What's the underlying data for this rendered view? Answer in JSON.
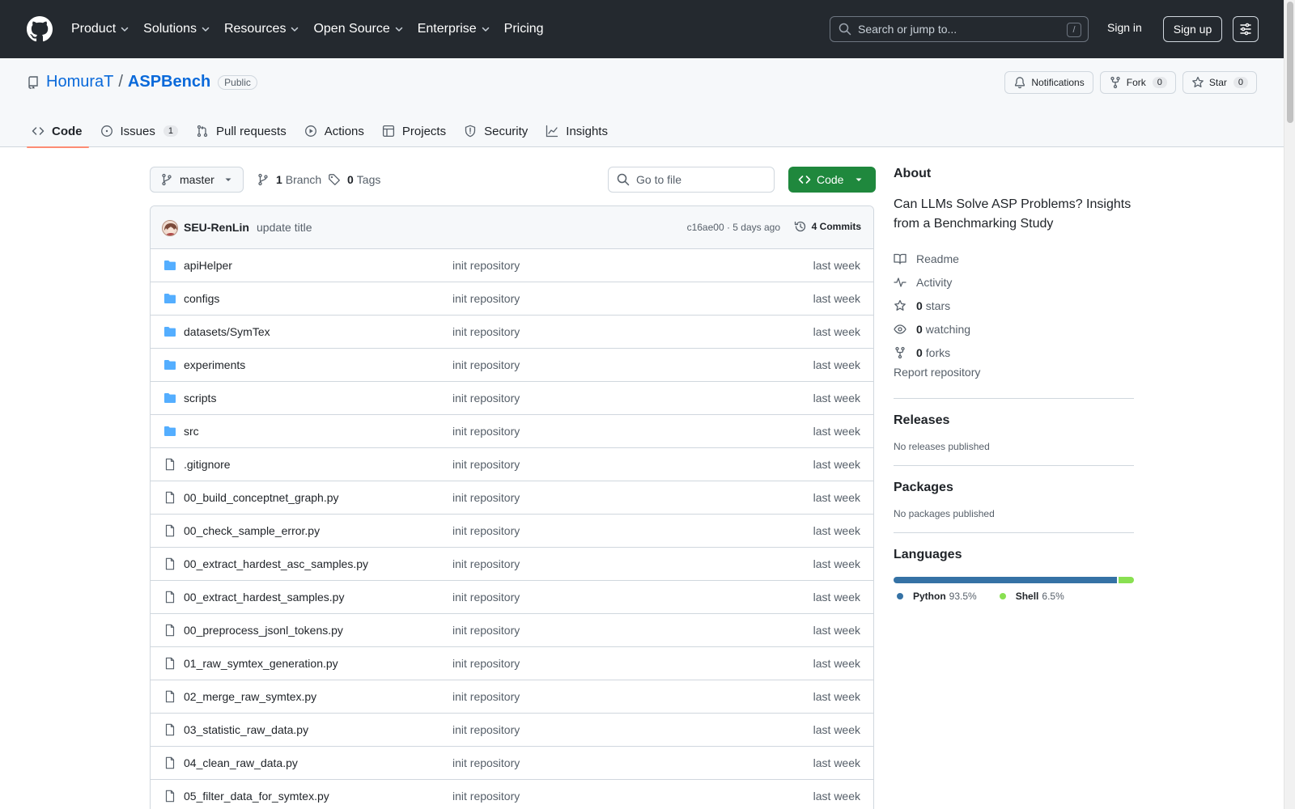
{
  "header": {
    "nav": [
      {
        "label": "Product",
        "has_menu": true
      },
      {
        "label": "Solutions",
        "has_menu": true
      },
      {
        "label": "Resources",
        "has_menu": true
      },
      {
        "label": "Open Source",
        "has_menu": true
      },
      {
        "label": "Enterprise",
        "has_menu": true
      },
      {
        "label": "Pricing",
        "has_menu": false
      }
    ],
    "search_placeholder": "Search or jump to...",
    "search_shortcut": "/",
    "sign_in": "Sign in",
    "sign_up": "Sign up"
  },
  "repo": {
    "owner": "HomuraT",
    "separator": "/",
    "name": "ASPBench",
    "visibility": "Public",
    "notifications_label": "Notifications",
    "fork_label": "Fork",
    "fork_count": "0",
    "star_label": "Star",
    "star_count": "0",
    "tabs": [
      {
        "label": "Code",
        "icon": "code-icon",
        "active": true,
        "count": ""
      },
      {
        "label": "Issues",
        "icon": "issue-icon",
        "active": false,
        "count": "1"
      },
      {
        "label": "Pull requests",
        "icon": "pull-request-icon",
        "active": false,
        "count": ""
      },
      {
        "label": "Actions",
        "icon": "play-icon",
        "active": false,
        "count": ""
      },
      {
        "label": "Projects",
        "icon": "table-icon",
        "active": false,
        "count": ""
      },
      {
        "label": "Security",
        "icon": "shield-icon",
        "active": false,
        "count": ""
      },
      {
        "label": "Insights",
        "icon": "graph-icon",
        "active": false,
        "count": ""
      }
    ]
  },
  "toolbar": {
    "branch": "master",
    "branch_count": "1",
    "branch_label": "Branch",
    "tag_count": "0",
    "tag_label": "Tags",
    "goto_placeholder": "Go to file",
    "code_button": "Code"
  },
  "commit": {
    "author": "SEU-RenLin",
    "message": "update title",
    "meta": "c16ae00 · 5 days ago",
    "commits_label": "4 Commits"
  },
  "files": [
    {
      "name": "apiHelper",
      "type": "dir",
      "message": "init repository",
      "date": "last week"
    },
    {
      "name": "configs",
      "type": "dir",
      "message": "init repository",
      "date": "last week"
    },
    {
      "name": "datasets/SymTex",
      "type": "dir",
      "message": "init repository",
      "date": "last week"
    },
    {
      "name": "experiments",
      "type": "dir",
      "message": "init repository",
      "date": "last week"
    },
    {
      "name": "scripts",
      "type": "dir",
      "message": "init repository",
      "date": "last week"
    },
    {
      "name": "src",
      "type": "dir",
      "message": "init repository",
      "date": "last week"
    },
    {
      "name": ".gitignore",
      "type": "file",
      "message": "init repository",
      "date": "last week"
    },
    {
      "name": "00_build_conceptnet_graph.py",
      "type": "file",
      "message": "init repository",
      "date": "last week"
    },
    {
      "name": "00_check_sample_error.py",
      "type": "file",
      "message": "init repository",
      "date": "last week"
    },
    {
      "name": "00_extract_hardest_asc_samples.py",
      "type": "file",
      "message": "init repository",
      "date": "last week"
    },
    {
      "name": "00_extract_hardest_samples.py",
      "type": "file",
      "message": "init repository",
      "date": "last week"
    },
    {
      "name": "00_preprocess_jsonl_tokens.py",
      "type": "file",
      "message": "init repository",
      "date": "last week"
    },
    {
      "name": "01_raw_symtex_generation.py",
      "type": "file",
      "message": "init repository",
      "date": "last week"
    },
    {
      "name": "02_merge_raw_symtex.py",
      "type": "file",
      "message": "init repository",
      "date": "last week"
    },
    {
      "name": "03_statistic_raw_data.py",
      "type": "file",
      "message": "init repository",
      "date": "last week"
    },
    {
      "name": "04_clean_raw_data.py",
      "type": "file",
      "message": "init repository",
      "date": "last week"
    },
    {
      "name": "05_filter_data_for_symtex.py",
      "type": "file",
      "message": "init repository",
      "date": "last week"
    }
  ],
  "about": {
    "title": "About",
    "description": "Can LLMs Solve ASP Problems? Insights from a Benchmarking Study",
    "readme": "Readme",
    "activity": "Activity",
    "stars_count": "0",
    "stars_label": "stars",
    "watching_count": "0",
    "watching_label": "watching",
    "forks_count": "0",
    "forks_label": "forks",
    "report": "Report repository"
  },
  "releases": {
    "title": "Releases",
    "note": "No releases published"
  },
  "packages": {
    "title": "Packages",
    "note": "No packages published"
  },
  "languages": {
    "title": "Languages",
    "items": [
      {
        "name": "Python",
        "percent": "93.5%",
        "value": 93.5,
        "color": "#3572A5"
      },
      {
        "name": "Shell",
        "percent": "6.5%",
        "value": 6.5,
        "color": "#89e051"
      }
    ]
  }
}
